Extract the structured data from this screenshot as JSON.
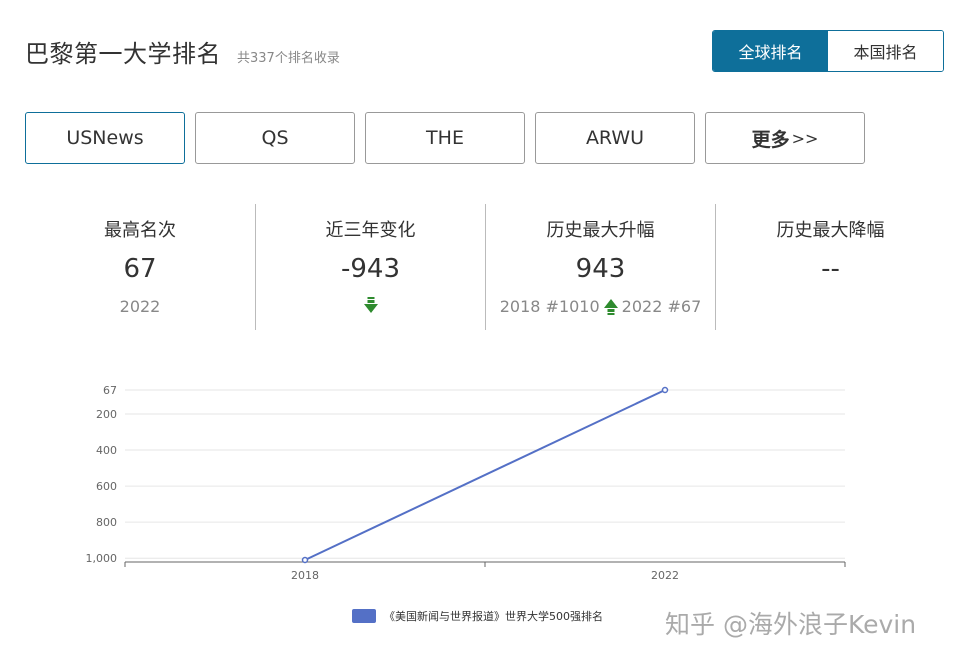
{
  "header": {
    "title": "巴黎第一大学排名",
    "subtitle": "共337个排名收录"
  },
  "scope_toggle": {
    "global": "全球排名",
    "national": "本国排名",
    "active": "global"
  },
  "tabs": [
    {
      "label": "USNews",
      "active": true
    },
    {
      "label": "QS",
      "active": false
    },
    {
      "label": "THE",
      "active": false
    },
    {
      "label": "ARWU",
      "active": false
    }
  ],
  "more_tab": {
    "label": "更多",
    "arrows": ">>"
  },
  "stats": {
    "best_rank": {
      "label": "最高名次",
      "value": "67",
      "sub": "2022"
    },
    "three_year_change": {
      "label": "近三年变化",
      "value": "-943",
      "arrow": "down"
    },
    "max_rise": {
      "label": "历史最大升幅",
      "value": "943",
      "from": "2018 #1010",
      "to": "2022 #67",
      "arrow": "up"
    },
    "max_drop": {
      "label": "历史最大降幅",
      "value": "--"
    }
  },
  "colors": {
    "accent": "#0e6f9a",
    "line": "#5470c6",
    "up_arrow": "#2e8b2e",
    "down_arrow": "#2e8b2e"
  },
  "chart_data": {
    "type": "line",
    "x": [
      "2018",
      "2022"
    ],
    "series": [
      {
        "name": "《美国新闻与世界报道》世界大学500强排名",
        "values": [
          1010,
          67
        ]
      }
    ],
    "y_ticks": [
      "67",
      "200",
      "400",
      "600",
      "800",
      "1,000"
    ],
    "y_tick_values": [
      67,
      200,
      400,
      600,
      800,
      1000
    ],
    "y_inverted": true,
    "ylim": [
      67,
      1010
    ],
    "grid": true,
    "legend_position": "bottom"
  },
  "watermark": "知乎 @海外浪子Kevin"
}
